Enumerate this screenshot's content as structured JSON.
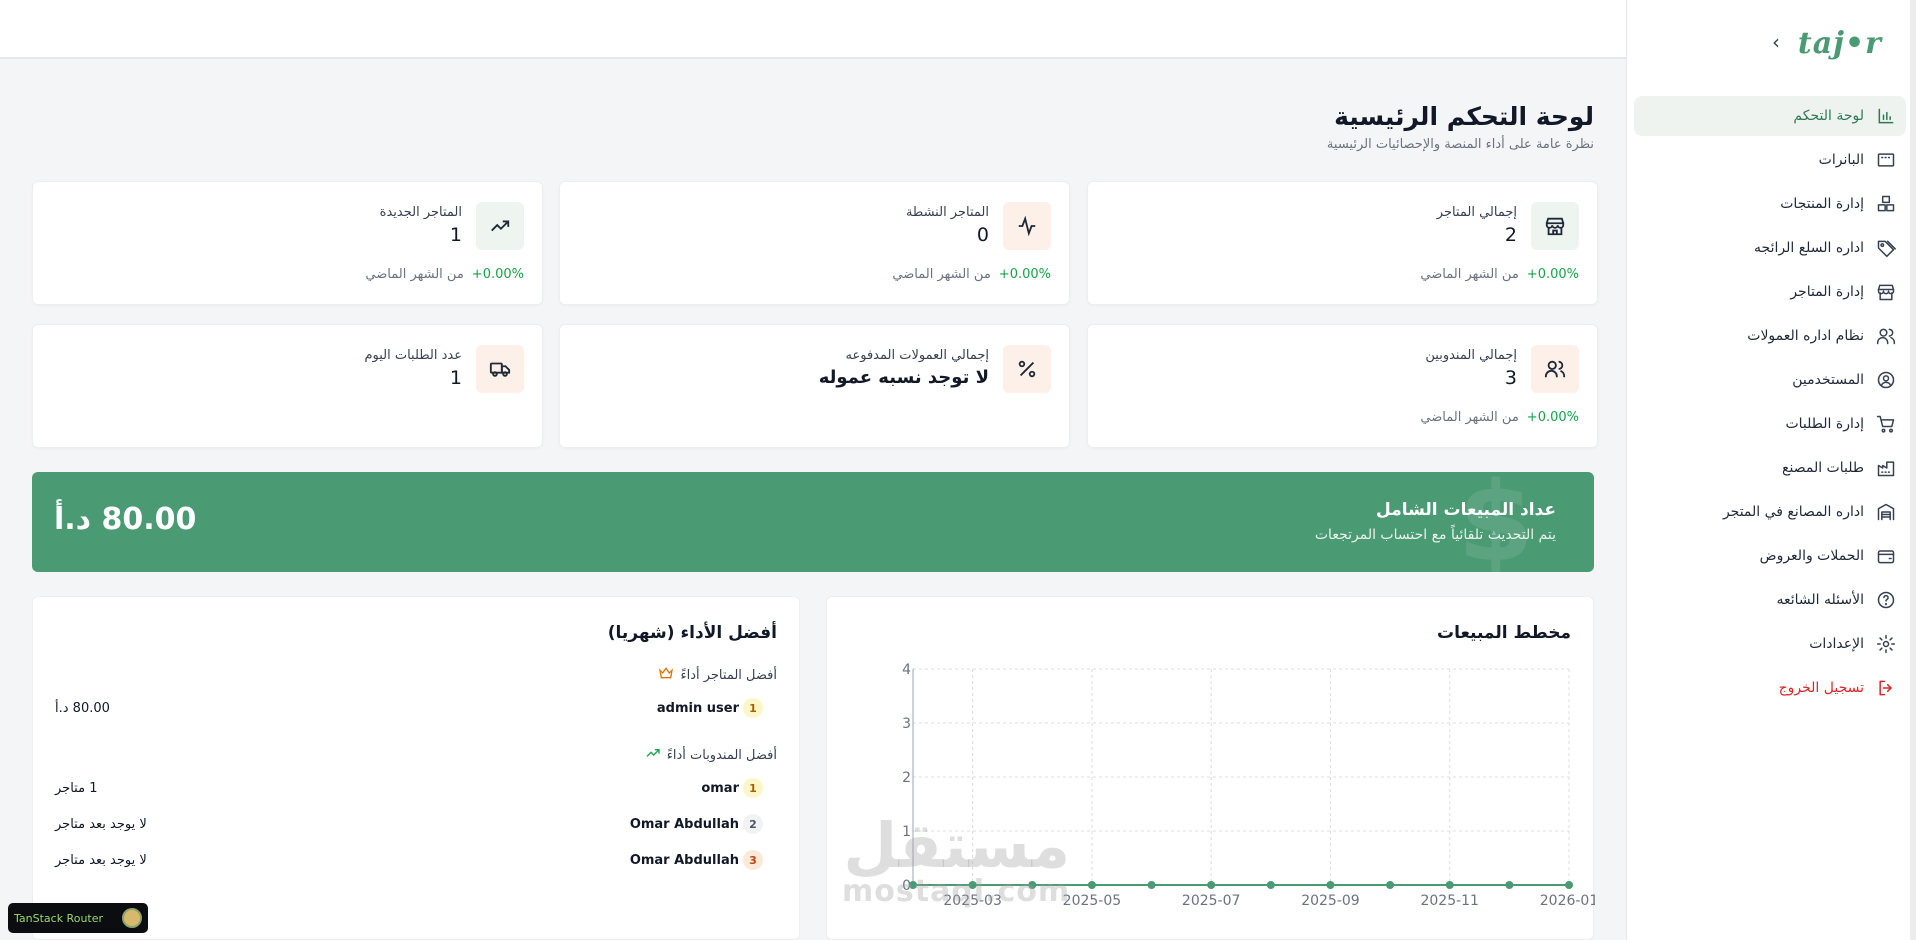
{
  "sidebar": {
    "logo": "taj•r",
    "collapse_icon": "chevron-left-icon",
    "items": [
      {
        "label": "لوحة التحكم",
        "icon": "chart-bars-icon",
        "active": true
      },
      {
        "label": "البانرات",
        "icon": "banner-icon"
      },
      {
        "label": "إدارة المنتجات",
        "icon": "boxes-icon"
      },
      {
        "label": "اداره السلع الرائجه",
        "icon": "tag-icon"
      },
      {
        "label": "إدارة المتاجر",
        "icon": "store-icon"
      },
      {
        "label": "نظام اداره العمولات",
        "icon": "users-icon"
      },
      {
        "label": "المستخدمين",
        "icon": "user-circle-icon"
      },
      {
        "label": "إدارة الطلبات",
        "icon": "cart-icon"
      },
      {
        "label": "طلبات المصنع",
        "icon": "factory-icon"
      },
      {
        "label": "اداره المصانع في المتجر",
        "icon": "warehouse-icon"
      },
      {
        "label": "الحملات والعروض",
        "icon": "wallet-icon"
      },
      {
        "label": "الأسئله الشائعه",
        "icon": "help-circle-icon"
      },
      {
        "label": "الإعدادات",
        "icon": "gear-icon"
      },
      {
        "label": "تسجيل الخروج",
        "icon": "logout-icon",
        "logout": true
      }
    ]
  },
  "header": {
    "title": "لوحة التحكم الرئيسية",
    "subtitle": "نظرة عامة على أداء المنصة والإحصائيات الرئيسية"
  },
  "stats": {
    "total_stores": {
      "label": "إجمالي المتاجر",
      "value": "2",
      "change": "+0.00%",
      "change_text": "من الشهر الماضي",
      "icon": "store-icon"
    },
    "active_stores": {
      "label": "المتاجر النشطة",
      "value": "0",
      "change": "+0.00%",
      "change_text": "من الشهر الماضي",
      "icon": "activity-icon"
    },
    "new_stores": {
      "label": "المتاجر الجديدة",
      "value": "1",
      "change": "+0.00%",
      "change_text": "من الشهر الماضي",
      "icon": "trending-up-icon"
    },
    "total_reps": {
      "label": "إجمالي المندوبين",
      "value": "3",
      "change": "+0.00%",
      "change_text": "من الشهر الماضي",
      "icon": "users-icon"
    },
    "commissions_paid": {
      "label": "إجمالي العمولات المدفوعه",
      "value": "لا توجد نسبه عموله",
      "icon": "percent-icon"
    },
    "orders_today": {
      "label": "عدد الطلبات اليوم",
      "value": "1",
      "icon": "truck-icon"
    }
  },
  "sales_counter": {
    "title": "عداد المبيعات الشامل",
    "subtitle": "يتم التحديث تلقائياً مع احتساب المرتجعات",
    "value": "80.00 د.أ",
    "watermark": "$"
  },
  "top_performers": {
    "title": "أفضل الأداء (شهريا)",
    "stores_heading": "أفضل المتاجر أداءً",
    "stores_icon": "crown-icon",
    "stores": [
      {
        "rank": "1",
        "name": "admin user",
        "value": "80.00 د.أ"
      }
    ],
    "reps_heading": "أفضل المندوبات أداءً",
    "reps_icon": "trending-up-icon",
    "reps": [
      {
        "rank": "1",
        "name": "omar",
        "value": "1 متاجر"
      },
      {
        "rank": "2",
        "name": "Omar Abdullah",
        "value": "لا يوجد بعد متاجر"
      },
      {
        "rank": "3",
        "name": "Omar Abdullah",
        "value": "لا يوجد بعد متاجر"
      }
    ]
  },
  "sales_chart_panel": {
    "title": "مخطط المبيعات"
  },
  "chart_data": {
    "type": "line",
    "title": "مخطط المبيعات",
    "x": [
      "2025-02",
      "2025-03",
      "2025-04",
      "2025-05",
      "2025-06",
      "2025-07",
      "2025-08",
      "2025-09",
      "2025-10",
      "2025-11",
      "2025-12",
      "2026-01"
    ],
    "x_tick_labels": [
      "2025-03",
      "2025-05",
      "2025-07",
      "2025-09",
      "2025-11",
      "2026-01"
    ],
    "series": [
      {
        "values": [
          0,
          0,
          0,
          0,
          0,
          0,
          0,
          0,
          0,
          0,
          0,
          0
        ]
      }
    ],
    "ylim": [
      0,
      4
    ],
    "y_ticks": [
      "0",
      "1",
      "2",
      "3",
      "4"
    ],
    "grid": true,
    "color": "#4a9a73"
  },
  "watermark": {
    "line1": "مستقل",
    "line2": "mostaql.com"
  },
  "devtools": {
    "label": "TanStack Router"
  },
  "colors": {
    "brand": "#4a9a73",
    "positive": "#16a34a",
    "danger": "#dc2626"
  }
}
